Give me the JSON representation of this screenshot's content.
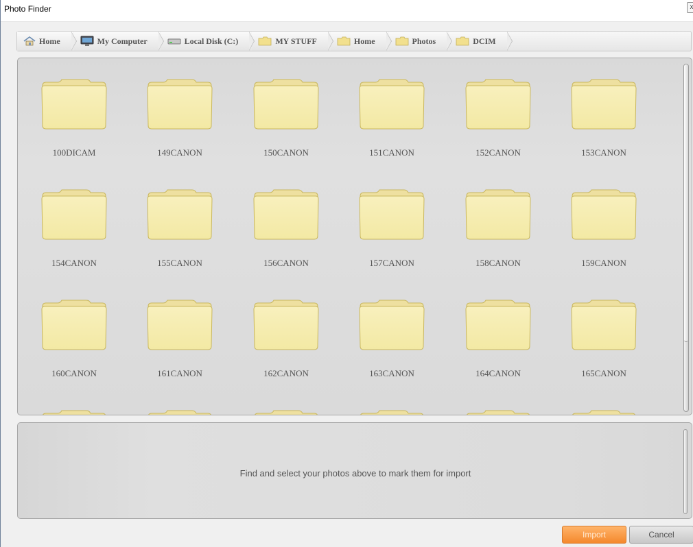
{
  "window": {
    "title": "Photo Finder",
    "close_glyph": "x"
  },
  "breadcrumb": [
    {
      "label": "Home",
      "icon": "home-icon"
    },
    {
      "label": "My Computer",
      "icon": "computer-icon"
    },
    {
      "label": "Local Disk (C:)",
      "icon": "drive-icon"
    },
    {
      "label": "MY STUFF",
      "icon": "folder-icon"
    },
    {
      "label": "Home",
      "icon": "folder-icon"
    },
    {
      "label": "Photos",
      "icon": "folder-icon"
    },
    {
      "label": "DCIM",
      "icon": "folder-icon"
    }
  ],
  "folders": [
    "100DICAM",
    "149CANON",
    "150CANON",
    "151CANON",
    "152CANON",
    "153CANON",
    "154CANON",
    "155CANON",
    "156CANON",
    "157CANON",
    "158CANON",
    "159CANON",
    "160CANON",
    "161CANON",
    "162CANON",
    "163CANON",
    "164CANON",
    "165CANON"
  ],
  "import_panel": {
    "hint": "Find and select your photos above to mark them for import"
  },
  "buttons": {
    "import_label": "Import",
    "cancel_label": "Cancel"
  },
  "colors": {
    "folder_fill": "#f3e9a4",
    "folder_edge": "#c9b75d",
    "import_accent": "#f4882c"
  }
}
